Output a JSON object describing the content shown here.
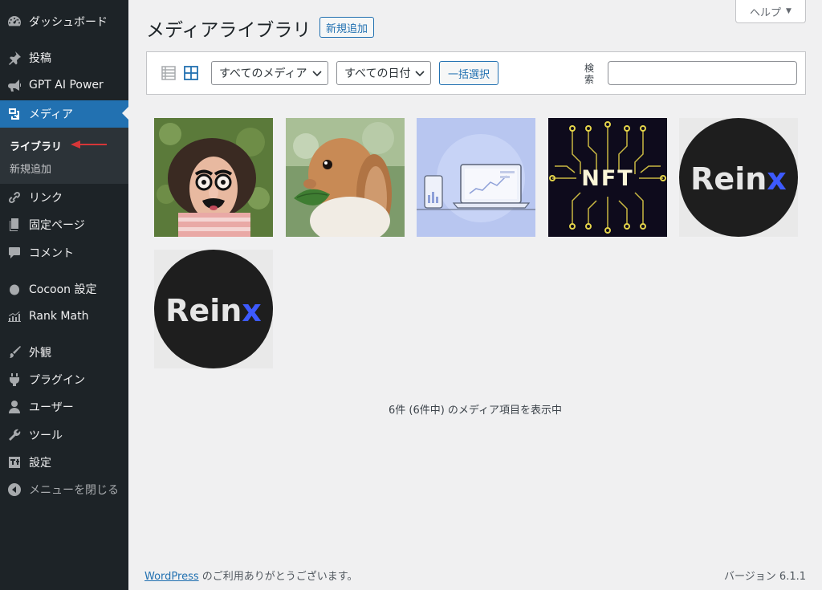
{
  "sidebar": {
    "items": [
      {
        "label": "ダッシュボード",
        "icon": "dashboard-icon"
      },
      {
        "label": "投稿",
        "icon": "pin-icon"
      },
      {
        "label": "GPT AI Power",
        "icon": "megaphone-icon"
      },
      {
        "label": "メディア",
        "icon": "media-icon",
        "active": true
      },
      {
        "label": "リンク",
        "icon": "link-icon"
      },
      {
        "label": "固定ページ",
        "icon": "page-icon"
      },
      {
        "label": "コメント",
        "icon": "comment-icon"
      },
      {
        "label": "Cocoon 設定",
        "icon": "circle-icon"
      },
      {
        "label": "Rank Math",
        "icon": "chart-icon"
      },
      {
        "label": "外観",
        "icon": "brush-icon"
      },
      {
        "label": "プラグイン",
        "icon": "plugin-icon"
      },
      {
        "label": "ユーザー",
        "icon": "user-icon"
      },
      {
        "label": "ツール",
        "icon": "wrench-icon"
      },
      {
        "label": "設定",
        "icon": "settings-icon"
      },
      {
        "label": "メニューを閉じる",
        "icon": "collapse-icon"
      }
    ],
    "submenu": {
      "library": "ライブラリ",
      "add_new": "新規追加"
    }
  },
  "header": {
    "title": "メディアライブラリ",
    "add_new": "新規追加",
    "help": "ヘルプ"
  },
  "toolbar": {
    "media_filter": "すべてのメディア",
    "date_filter": "すべての日付",
    "bulk_select": "一括選択",
    "search_label": "検索",
    "search_value": ""
  },
  "media_items": [
    {
      "name": "person-with-disguise-glasses-image"
    },
    {
      "name": "rabbit-eating-leaf-image"
    },
    {
      "name": "laptop-analytics-illustration-image"
    },
    {
      "name": "nft-circuit-image",
      "text": "NFT"
    },
    {
      "name": "reinx-logo-image",
      "text": "Reinx"
    },
    {
      "name": "reinx-logo-image",
      "text": "Reinx"
    }
  ],
  "status": {
    "count_text": "6件 (6件中) のメディア項目を表示中"
  },
  "footer": {
    "link": "WordPress",
    "thanks": " のご利用ありがとうございます。",
    "version": "バージョン 6.1.1"
  },
  "colors": {
    "accent": "#2271b1",
    "sidebar": "#1d2327",
    "arrow": "#d63638",
    "reinx_x": "#3d5afe"
  }
}
